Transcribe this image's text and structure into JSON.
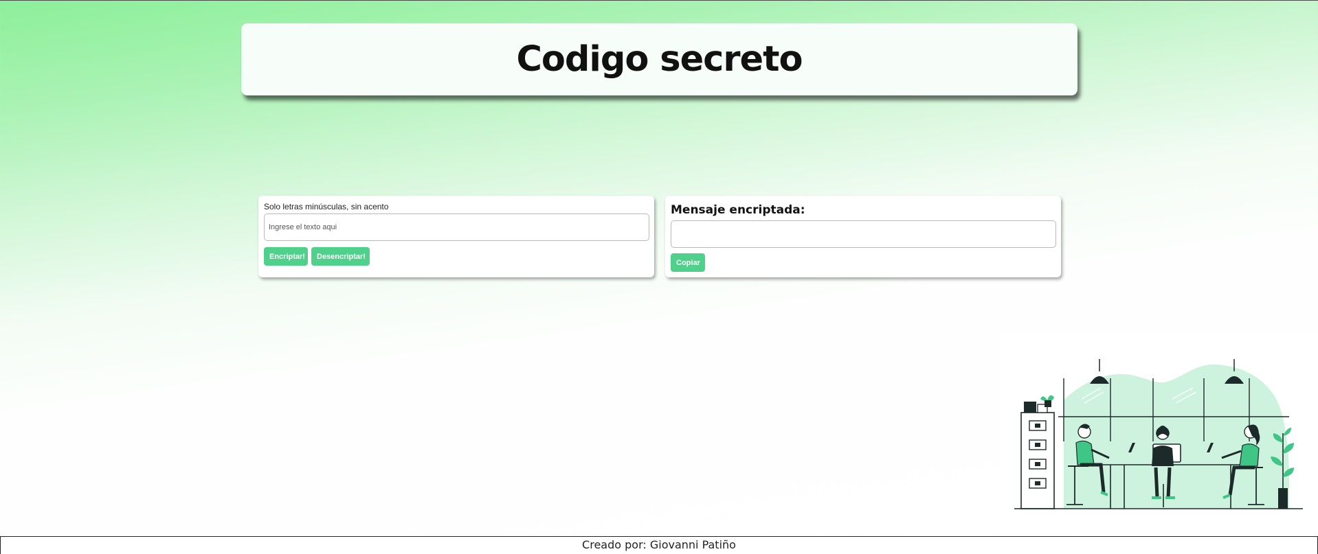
{
  "header": {
    "title": "Codigo secreto"
  },
  "encrypt_panel": {
    "hint": "Solo letras minúsculas, sin acento",
    "input_placeholder": "Ingrese el texto aqui",
    "input_value": "",
    "encrypt_label": "Encriptar!",
    "decrypt_label": "Desencriptar!"
  },
  "result_panel": {
    "title": "Mensaje encriptada:",
    "output_value": "",
    "copy_label": "Copiar"
  },
  "illustration": {
    "icon": "office-workers-illustration"
  },
  "footer": {
    "credit": "Creado por: Giovanni Patiño"
  },
  "colors": {
    "accent": "#4fd18c",
    "background_top": "#8cf09a",
    "background_bottom": "#ffffff",
    "illustration_mint": "#c8f2dc",
    "illustration_green": "#3fc585",
    "illustration_dark": "#1c2a2a"
  }
}
